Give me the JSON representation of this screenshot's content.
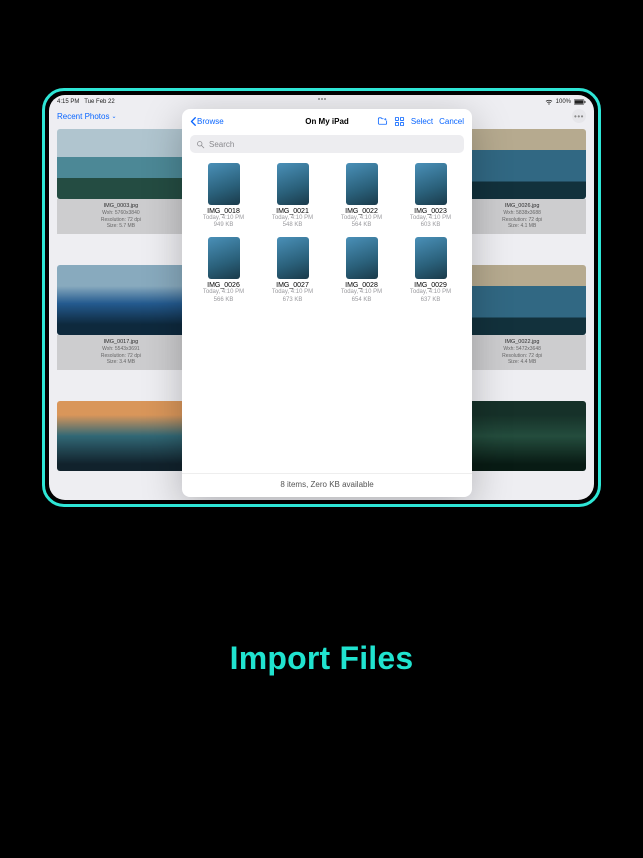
{
  "statusbar": {
    "time": "4:15 PM",
    "date": "Tue Feb 22",
    "battery": "100%"
  },
  "header": {
    "title": "Recent Photos"
  },
  "bg_cards": [
    {
      "name": "IMG_0003.jpg",
      "wxh": "Wxh: 5760x3840",
      "res": "Resolution: 72 dpi",
      "size": "Size: 5.7 MB"
    },
    {
      "name": "IMG_0026.jpg",
      "wxh": "Wxh: 5838x3688",
      "res": "Resolution: 72 dpi",
      "size": "Size: 4.1 MB"
    },
    {
      "name": "IMG_0017.jpg",
      "wxh": "Wxh: 5543x3691",
      "res": "Resolution: 72 dpi",
      "size": "Size: 3.4 MB"
    },
    {
      "name": "IMG_0022.jpg",
      "wxh": "Wxh: 5472x3648",
      "res": "Resolution: 72 dpi",
      "size": "Size: 4.4 MB"
    }
  ],
  "picker": {
    "back_label": "Browse",
    "title": "On My iPad",
    "select_label": "Select",
    "cancel_label": "Cancel",
    "search_placeholder": "Search",
    "footer": "8 items, Zero KB available",
    "files": [
      {
        "name": "IMG_0018",
        "date": "Today, 4:10 PM",
        "size": "949 KB"
      },
      {
        "name": "IMG_0021",
        "date": "Today, 4:10 PM",
        "size": "548 KB"
      },
      {
        "name": "IMG_0022",
        "date": "Today, 4:10 PM",
        "size": "564 KB"
      },
      {
        "name": "IMG_0023",
        "date": "Today, 4:10 PM",
        "size": "603 KB"
      },
      {
        "name": "IMG_0026",
        "date": "Today, 4:10 PM",
        "size": "566 KB"
      },
      {
        "name": "IMG_0027",
        "date": "Today, 4:10 PM",
        "size": "673 KB"
      },
      {
        "name": "IMG_0028",
        "date": "Today, 4:10 PM",
        "size": "654 KB"
      },
      {
        "name": "IMG_0029",
        "date": "Today, 4:10 PM",
        "size": "637 KB"
      }
    ]
  },
  "headline": "Import Files"
}
